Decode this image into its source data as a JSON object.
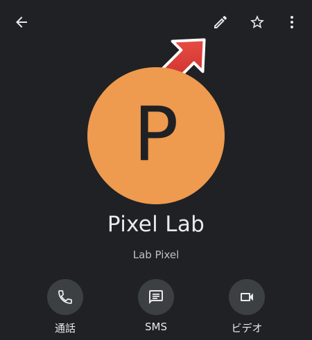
{
  "contact": {
    "avatar_letter": "P",
    "avatar_color": "#ee9a4f",
    "name": "Pixel Lab",
    "subname": "Lab Pixel"
  },
  "toolbar": {
    "back_icon": "arrow-back-icon",
    "edit_icon": "pencil-icon",
    "star_icon": "star-outline-icon",
    "more_icon": "more-vert-icon"
  },
  "annotation": {
    "icon": "red-arrow-pointer",
    "color": "#e53935"
  },
  "actions": [
    {
      "label": "通話",
      "icon": "phone-icon"
    },
    {
      "label": "SMS",
      "icon": "message-icon"
    },
    {
      "label": "ビデオ",
      "icon": "videocam-icon"
    }
  ]
}
